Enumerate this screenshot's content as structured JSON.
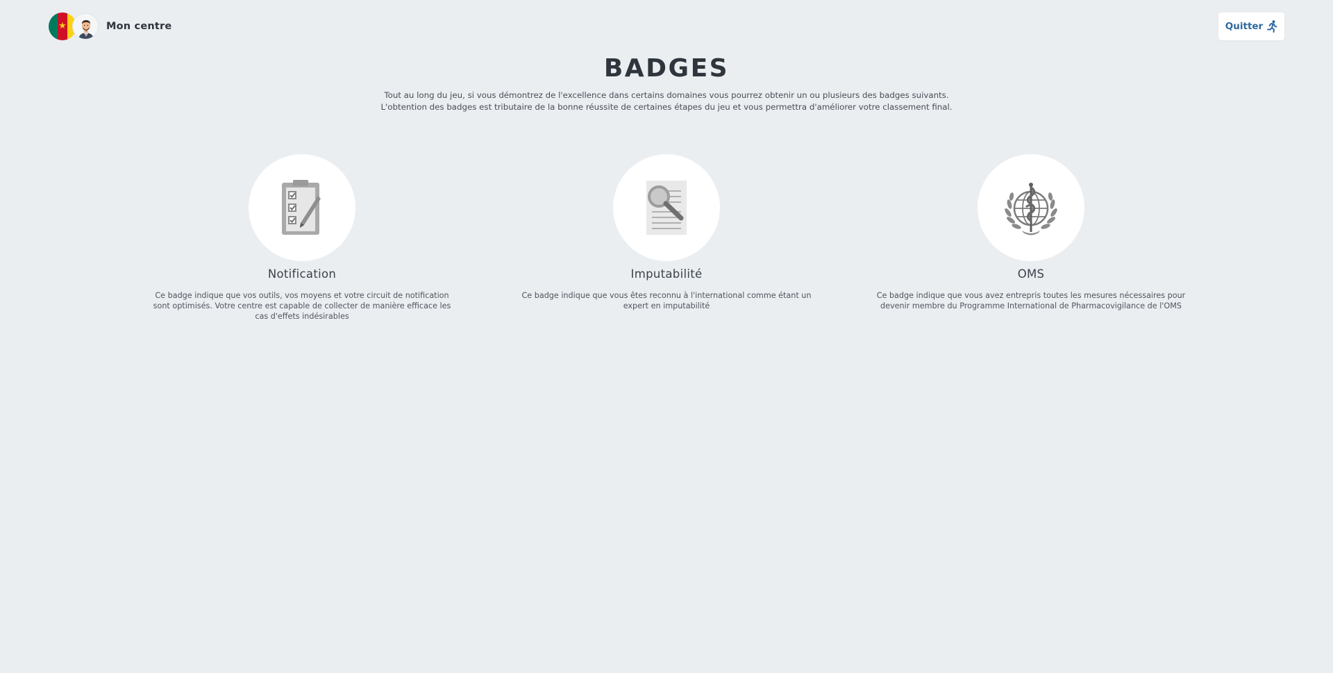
{
  "header": {
    "center_name": "Mon centre",
    "quit_label": "Quitter",
    "flag_colors": [
      "#007a5e",
      "#ce1126",
      "#fcd116"
    ],
    "flag_icon": "cameroon-flag-icon",
    "avatar_icon": "user-avatar-icon",
    "quit_icon": "running-person-icon"
  },
  "page": {
    "title": "BADGES",
    "intro": "Tout au long du jeu, si vous démontrez de l'excellence dans certains domaines vous pourrez obtenir un ou plusieurs des badges suivants. L'obtention des badges est tributaire de la bonne réussite de certaines étapes du jeu et vous permettra d'améliorer votre classement final."
  },
  "badges": [
    {
      "name": "Notification",
      "icon": "clipboard-checklist-icon",
      "description": "Ce badge indique que vos outils, vos moyens et votre circuit de notification sont optimisés. Votre centre est capable de collecter de manière efficace les cas d'effets indésirables"
    },
    {
      "name": "Imputabilité",
      "icon": "document-magnifier-icon",
      "description": "Ce badge indique que vous êtes reconnu à l'international comme étant un expert en imputabilité"
    },
    {
      "name": "OMS",
      "icon": "who-emblem-icon",
      "description": "Ce badge indique que vous avez entrepris toutes les mesures nécessaires pour devenir membre du Programme International de Pharmacovigilance de l'OMS"
    }
  ],
  "colors": {
    "background": "#ebeef1",
    "accent": "#2d6a9f",
    "badge_icon": "#9a9a9a"
  }
}
